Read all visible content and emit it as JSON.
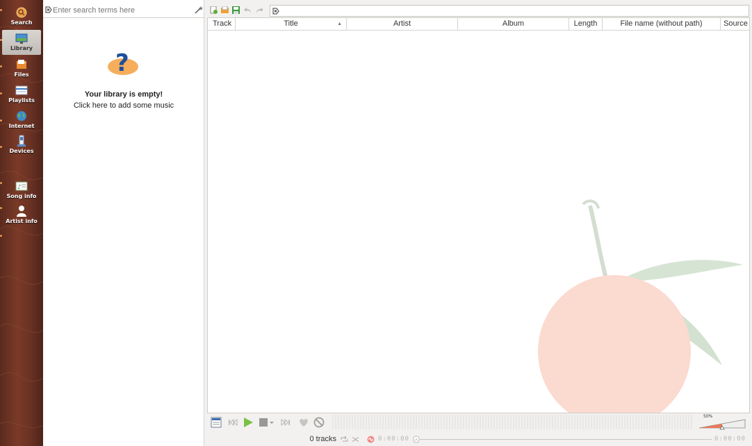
{
  "sidebar": {
    "items": [
      {
        "label": "Search",
        "icon": "search-icon"
      },
      {
        "label": "Library",
        "icon": "library-icon",
        "active": true
      },
      {
        "label": "Files",
        "icon": "folder-icon"
      },
      {
        "label": "Playlists",
        "icon": "playlist-icon"
      },
      {
        "label": "Internet",
        "icon": "globe-icon"
      },
      {
        "label": "Devices",
        "icon": "device-icon"
      },
      {
        "label": "Song info",
        "icon": "song-info-icon"
      },
      {
        "label": "Artist info",
        "icon": "artist-icon"
      }
    ]
  },
  "library": {
    "search_placeholder": "Enter search terms here",
    "empty_title": "Your library is empty!",
    "empty_link": "Click here to add some music"
  },
  "playlist": {
    "columns": [
      "Track",
      "Title",
      "Artist",
      "Album",
      "Length",
      "File name (without path)",
      "Source"
    ],
    "sorted_column": "Title"
  },
  "player": {
    "volume_label": "50%",
    "volume": 0.5,
    "track_count": "0 tracks",
    "elapsed": "0:00:00",
    "total": "0:00:00"
  },
  "colors": {
    "sidebar_wood": "#6a3224",
    "accent_orange": "#f08a30",
    "play_green": "#7bc043"
  }
}
